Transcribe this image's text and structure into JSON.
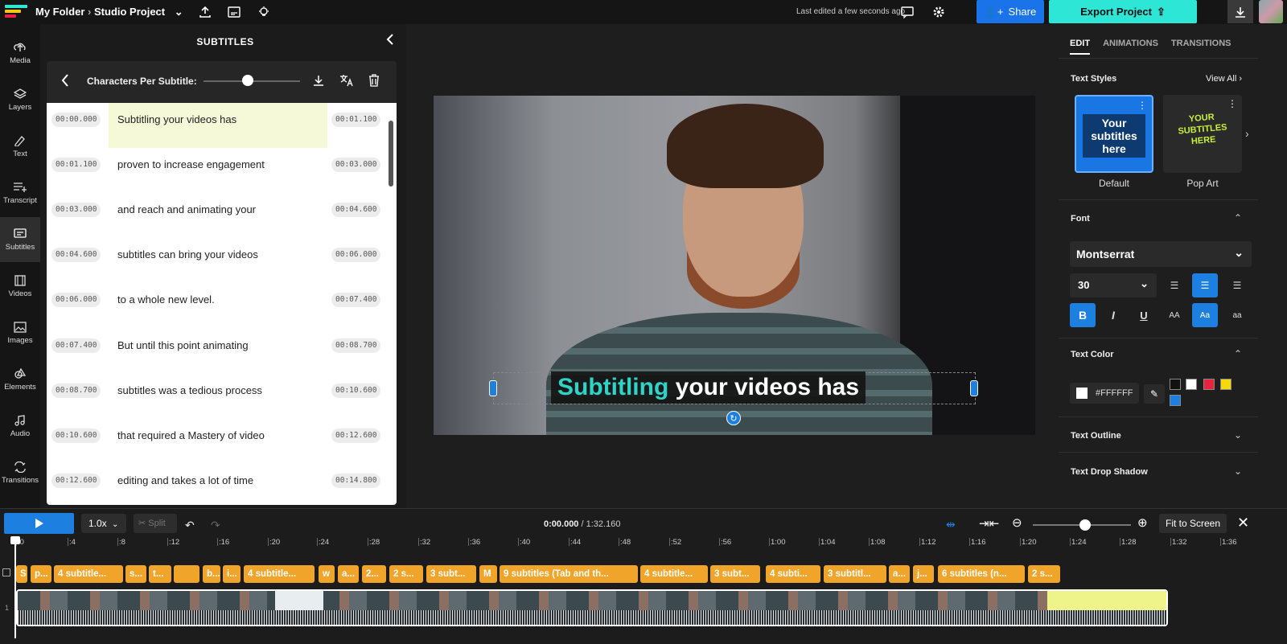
{
  "header": {
    "folder": "My Folder",
    "separator": "›",
    "project": "Studio Project",
    "last_edited": "Last edited a few seconds ago",
    "share_label": "Share",
    "export_label": "Export Project"
  },
  "nav": [
    {
      "label": "Media",
      "icon": "upload-icon"
    },
    {
      "label": "Layers",
      "icon": "layers-icon"
    },
    {
      "label": "Text",
      "icon": "text-icon"
    },
    {
      "label": "Transcript",
      "icon": "transcript-icon"
    },
    {
      "label": "Subtitles",
      "icon": "subtitles-icon"
    },
    {
      "label": "Videos",
      "icon": "film-icon"
    },
    {
      "label": "Images",
      "icon": "image-icon"
    },
    {
      "label": "Elements",
      "icon": "shapes-icon"
    },
    {
      "label": "Audio",
      "icon": "music-icon"
    },
    {
      "label": "Transitions",
      "icon": "transition-icon"
    }
  ],
  "subtitles_panel": {
    "title": "SUBTITLES",
    "chars_label": "Characters Per Subtitle:",
    "rows": [
      {
        "start": "00:00.000",
        "text": "Subtitling your videos has",
        "end": "00:01.100"
      },
      {
        "start": "00:01.100",
        "text": "proven to increase engagement",
        "end": "00:03.000"
      },
      {
        "start": "00:03.000",
        "text": "and reach and animating your",
        "end": "00:04.600"
      },
      {
        "start": "00:04.600",
        "text": "subtitles can bring your videos",
        "end": "00:06.000"
      },
      {
        "start": "00:06.000",
        "text": "to a whole new level.",
        "end": "00:07.400"
      },
      {
        "start": "00:07.400",
        "text": "But until this point animating",
        "end": "00:08.700"
      },
      {
        "start": "00:08.700",
        "text": "subtitles was a tedious process",
        "end": "00:10.600"
      },
      {
        "start": "00:10.600",
        "text": "that required a Mastery of video",
        "end": "00:12.600"
      },
      {
        "start": "00:12.600",
        "text": "editing and takes a lot of time",
        "end": "00:14.800"
      }
    ]
  },
  "preview": {
    "caption_highlight": "Subtitling",
    "caption_rest": " your videos has"
  },
  "right_panel": {
    "tabs": [
      "EDIT",
      "ANIMATIONS",
      "TRANSITIONS"
    ],
    "text_styles_label": "Text Styles",
    "view_all": "View All ›",
    "styles": [
      {
        "name": "Default",
        "preview": "Your subtitles here"
      },
      {
        "name": "Pop Art",
        "preview": "YOUR SUBTITLES HERE"
      }
    ],
    "font_label": "Font",
    "font_value": "Montserrat",
    "size_value": "30",
    "text_color_label": "Text Color",
    "text_color_value": "#FFFFFF",
    "text_outline_label": "Text Outline",
    "drop_shadow_label": "Text Drop Shadow",
    "palette": [
      "#111111",
      "#ffffff",
      "#e8243c",
      "#f5d90a",
      "#1d7fe0"
    ]
  },
  "timeline": {
    "speed": "1.0x",
    "split": "✂ Split",
    "current_time": "0:00.000",
    "total_time": "/ 1:32.160",
    "fit_label": "Fit to Screen",
    "ticks": [
      ":0",
      ":4",
      ":8",
      ":12",
      ":16",
      ":20",
      ":24",
      ":28",
      ":32",
      ":36",
      ":40",
      ":44",
      ":48",
      ":52",
      ":56",
      "1:00",
      "1:04",
      "1:08",
      "1:12",
      "1:16",
      "1:20",
      "1:24",
      "1:28",
      "1:32",
      "1:36"
    ],
    "chips": [
      "S",
      "p...",
      "4 subtitle...",
      "s...",
      "t...",
      "",
      "b...",
      "i...",
      "4 subtitle...",
      "w",
      "a...",
      "2...",
      "2 s...",
      "3 subt...",
      "M",
      "9 subtitles (Tab and th...",
      "4 subtitle...",
      "3 subt...",
      "4 subti...",
      "3 subtitl...",
      "a...",
      "j...",
      "6 subtitles (n...",
      "2 s..."
    ]
  }
}
